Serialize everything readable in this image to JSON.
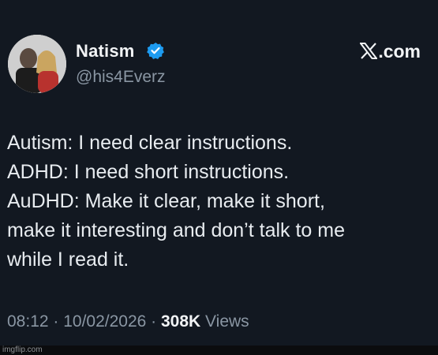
{
  "post": {
    "author": {
      "display_name": "Natism",
      "handle": "@his4Everz",
      "verified_icon": "verified-badge-icon",
      "verified_color": "#1d9bf0"
    },
    "site_logo": {
      "icon": "x-logo-icon",
      "text": ".com"
    },
    "body_lines": [
      "Autism: I need clear instructions.",
      "ADHD: I need short instructions.",
      "AuDHD: Make it clear, make it short,",
      "make it interesting and don’t talk to me",
      "while I read it."
    ],
    "timestamp": "08:12 · 10/02/2026 ·",
    "views_count": "308K",
    "views_label": "Views"
  },
  "watermark": "imgflip.com",
  "colors": {
    "background": "#121821",
    "text": "#e8ecf0",
    "muted": "#8a96a3"
  }
}
